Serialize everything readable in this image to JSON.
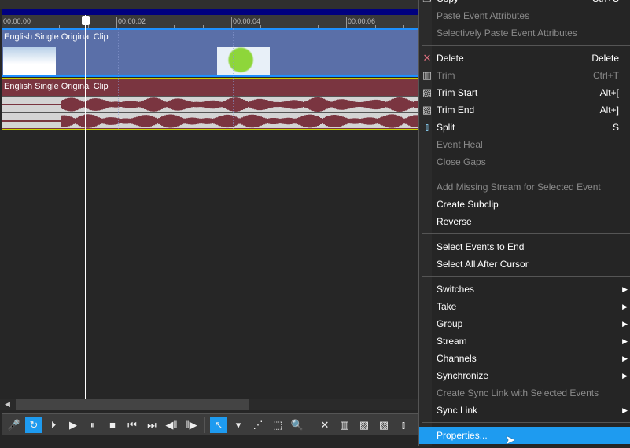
{
  "timeline": {
    "ruler_labels": [
      "00:00:00",
      "00:00:02",
      "00:00:04",
      "00:00:06"
    ],
    "video_clip_name": "English Single Original Clip",
    "audio_clip_name": "English Single Original Clip",
    "colors": {
      "video": "#5a6fa8",
      "audio": "#7a3540",
      "selection": "#1e9bf0"
    }
  },
  "toolbar": [
    {
      "name": "record-icon",
      "glyph": "🎤"
    },
    {
      "name": "loop-icon",
      "glyph": "↻",
      "active": true
    },
    {
      "name": "play-from-start-icon",
      "glyph": "⏵"
    },
    {
      "name": "play-icon",
      "glyph": "▶"
    },
    {
      "name": "pause-icon",
      "glyph": "⏸"
    },
    {
      "name": "stop-icon",
      "glyph": "■"
    },
    {
      "name": "go-to-start-icon",
      "glyph": "⏮"
    },
    {
      "name": "go-to-end-icon",
      "glyph": "⏭"
    },
    {
      "name": "previous-frame-icon",
      "glyph": "◀‖"
    },
    {
      "name": "next-frame-icon",
      "glyph": "‖▶"
    },
    {
      "sep": true
    },
    {
      "name": "normal-edit-tool-icon",
      "glyph": "↖",
      "active": true
    },
    {
      "name": "edit-tool-dropdown-icon",
      "glyph": "▾"
    },
    {
      "name": "envelope-tool-icon",
      "glyph": "⋰"
    },
    {
      "name": "selection-tool-icon",
      "glyph": "⬚"
    },
    {
      "name": "zoom-tool-icon",
      "glyph": "🔍"
    },
    {
      "sep": true
    },
    {
      "name": "delete-icon",
      "glyph": "✕"
    },
    {
      "name": "trim-icon",
      "glyph": "▥"
    },
    {
      "name": "trim-start-icon",
      "glyph": "▨"
    },
    {
      "name": "trim-end-icon",
      "glyph": "▧"
    },
    {
      "name": "split-icon",
      "glyph": "⫾"
    }
  ],
  "menu": [
    {
      "label": "Copy",
      "shortcut": "Ctrl+C",
      "icon": "copy-icon",
      "glyph": "❐"
    },
    {
      "label": "Paste Event Attributes",
      "disabled": true
    },
    {
      "label": "Selectively Paste Event Attributes",
      "disabled": true
    },
    {
      "sep": true
    },
    {
      "label": "Delete",
      "shortcut": "Delete",
      "icon": "delete-icon",
      "glyph": "✕",
      "color": "#e07080"
    },
    {
      "label": "Trim",
      "shortcut": "Ctrl+T",
      "disabled": true,
      "icon": "trim-icon",
      "glyph": "▥"
    },
    {
      "label": "Trim Start",
      "shortcut": "Alt+[",
      "icon": "trim-start-icon",
      "glyph": "▨"
    },
    {
      "label": "Trim End",
      "shortcut": "Alt+]",
      "icon": "trim-end-icon",
      "glyph": "▧"
    },
    {
      "label": "Split",
      "shortcut": "S",
      "icon": "split-icon",
      "glyph": "⫾",
      "color": "#7fc0e0"
    },
    {
      "label": "Event Heal",
      "disabled": true
    },
    {
      "label": "Close Gaps",
      "disabled": true
    },
    {
      "sep": true
    },
    {
      "label": "Add Missing Stream for Selected Event",
      "disabled": true
    },
    {
      "label": "Create Subclip"
    },
    {
      "label": "Reverse"
    },
    {
      "sep": true
    },
    {
      "label": "Select Events to End"
    },
    {
      "label": "Select All After Cursor"
    },
    {
      "sep": true
    },
    {
      "label": "Switches",
      "submenu": true
    },
    {
      "label": "Take",
      "submenu": true
    },
    {
      "label": "Group",
      "submenu": true
    },
    {
      "label": "Stream",
      "submenu": true
    },
    {
      "label": "Channels",
      "submenu": true
    },
    {
      "label": "Synchronize",
      "submenu": true
    },
    {
      "label": "Create Sync Link with Selected Events",
      "disabled": true
    },
    {
      "label": "Sync Link",
      "submenu": true
    },
    {
      "sep": true
    },
    {
      "label": "Properties...",
      "highlighted": true
    }
  ]
}
